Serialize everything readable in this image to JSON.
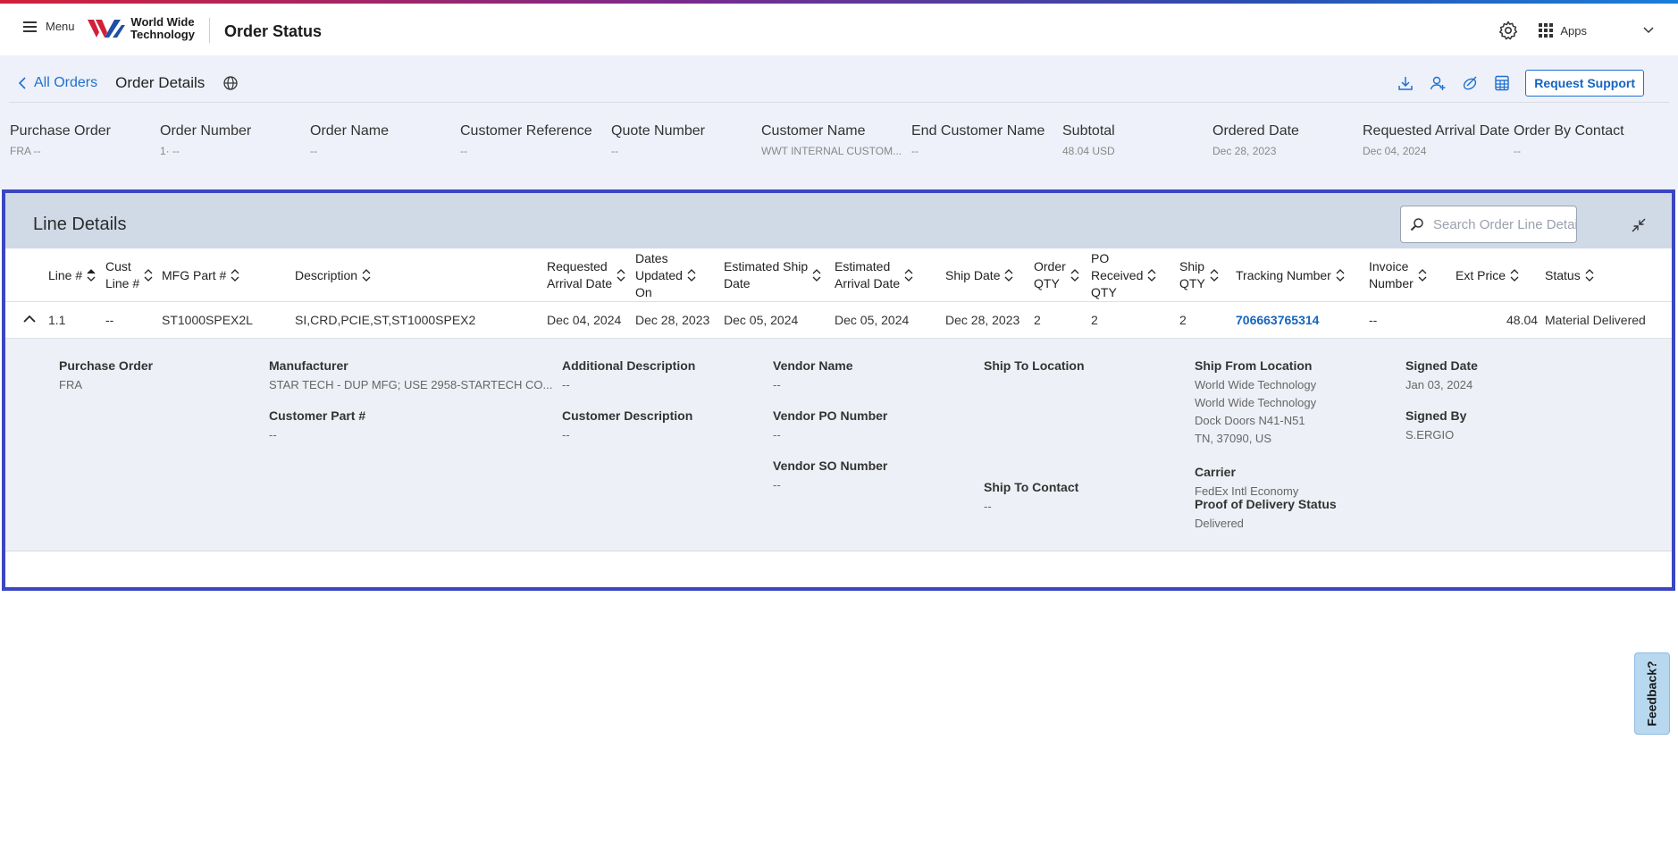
{
  "header": {
    "menu_label": "Menu",
    "brand_line1": "World Wide",
    "brand_line2": "Technology",
    "app_title": "Order Status",
    "apps_label": "Apps"
  },
  "breadcrumb": {
    "back_label": "All Orders",
    "current": "Order Details"
  },
  "actions": {
    "request_support": "Request Support"
  },
  "summary": [
    {
      "key": "Purchase Order",
      "value": "FRA   --"
    },
    {
      "key": "Order Number",
      "value": "1·  --"
    },
    {
      "key": "Order Name",
      "value": "--"
    },
    {
      "key": "Customer Reference",
      "value": "--"
    },
    {
      "key": "Quote Number",
      "value": "--"
    },
    {
      "key": "Customer Name",
      "value": "WWT INTERNAL CUSTOM..."
    },
    {
      "key": "End Customer Name",
      "value": "--"
    },
    {
      "key": "Subtotal",
      "value": "48.04 USD"
    },
    {
      "key": "Ordered Date",
      "value": "Dec 28, 2023"
    },
    {
      "key": "Requested Arrival Date",
      "value": "Dec 04, 2024"
    },
    {
      "key": "Order By Contact",
      "value": "--"
    }
  ],
  "line_details": {
    "title": "Line Details",
    "search_placeholder": "Search Order Line Details",
    "columns": [
      {
        "l1": "Line #",
        "l2": "",
        "l3": ""
      },
      {
        "l1": "Cust",
        "l2": "Line #",
        "l3": ""
      },
      {
        "l1": "MFG Part #",
        "l2": "",
        "l3": ""
      },
      {
        "l1": "Description",
        "l2": "",
        "l3": ""
      },
      {
        "l1": "Requested",
        "l2": "Arrival Date",
        "l3": ""
      },
      {
        "l1": "Dates",
        "l2": "Updated",
        "l3": "On"
      },
      {
        "l1": "Estimated Ship",
        "l2": "Date",
        "l3": ""
      },
      {
        "l1": "Estimated",
        "l2": "Arrival Date",
        "l3": ""
      },
      {
        "l1": "Ship Date",
        "l2": "",
        "l3": ""
      },
      {
        "l1": "Order",
        "l2": "QTY",
        "l3": ""
      },
      {
        "l1": "PO",
        "l2": "Received",
        "l3": "QTY"
      },
      {
        "l1": "Ship",
        "l2": "QTY",
        "l3": ""
      },
      {
        "l1": "Tracking Number",
        "l2": "",
        "l3": ""
      },
      {
        "l1": "Invoice",
        "l2": "Number",
        "l3": ""
      },
      {
        "l1": "Ext Price",
        "l2": "",
        "l3": ""
      },
      {
        "l1": "Status",
        "l2": "",
        "l3": ""
      }
    ],
    "row": {
      "line": "1.1",
      "cust_line": "--",
      "mfg_part": "ST1000SPEX2L",
      "description": "SI,CRD,PCIE,ST,ST1000SPEX2",
      "requested_arrival": "Dec 04, 2024",
      "dates_updated": "Dec 28, 2023",
      "est_ship": "Dec 05, 2024",
      "est_arrival": "Dec 05, 2024",
      "ship_date": "Dec 28, 2023",
      "order_qty": "2",
      "po_received_qty": "2",
      "ship_qty": "2",
      "tracking": "706663765314",
      "invoice": "--",
      "ext_price": "48.04",
      "status": "Material Delivered"
    },
    "detail": {
      "purchase_order": {
        "key": "Purchase Order",
        "value": "FRA"
      },
      "manufacturer": {
        "key": "Manufacturer",
        "value": "STAR TECH - DUP MFG; USE 2958-STARTECH CO..."
      },
      "customer_part": {
        "key": "Customer Part #",
        "value": "--"
      },
      "additional_description": {
        "key": "Additional Description",
        "value": "--"
      },
      "customer_description": {
        "key": "Customer Description",
        "value": "--"
      },
      "vendor_name": {
        "key": "Vendor Name",
        "value": "--"
      },
      "vendor_po": {
        "key": "Vendor PO Number",
        "value": "--"
      },
      "vendor_so": {
        "key": "Vendor SO Number",
        "value": "--"
      },
      "ship_to_location": {
        "key": "Ship To Location",
        "value": ""
      },
      "ship_to_contact": {
        "key": "Ship To Contact",
        "value": "--"
      },
      "ship_from_location": {
        "key": "Ship From Location",
        "lines": [
          "World Wide Technology",
          "World Wide Technology",
          "Dock Doors N41-N51",
          "TN, 37090, US"
        ]
      },
      "carrier": {
        "key": "Carrier",
        "value": "FedEx Intl Economy"
      },
      "pod_status": {
        "key": "Proof of Delivery Status",
        "value": "Delivered"
      },
      "signed_date": {
        "key": "Signed Date",
        "value": "Jan 03, 2024"
      },
      "signed_by": {
        "key": "Signed By",
        "value": "S.ERGIO"
      }
    }
  },
  "feedback_label": "Feedback?",
  "colors": {
    "accent": "#1565c0",
    "panel_border": "#3b46c2",
    "band_bg": "#eef1f9",
    "panel_head_bg": "#d0d9e6"
  },
  "icons": [
    "menu-icon",
    "brand-logo",
    "gear-icon",
    "apps-grid-icon",
    "chevron-down-icon",
    "chevron-left-icon",
    "globe-icon",
    "download-icon",
    "user-add-icon",
    "link-icon",
    "calculator-icon",
    "search-icon",
    "collapse-icon",
    "sort-icon",
    "chevron-up-icon"
  ]
}
